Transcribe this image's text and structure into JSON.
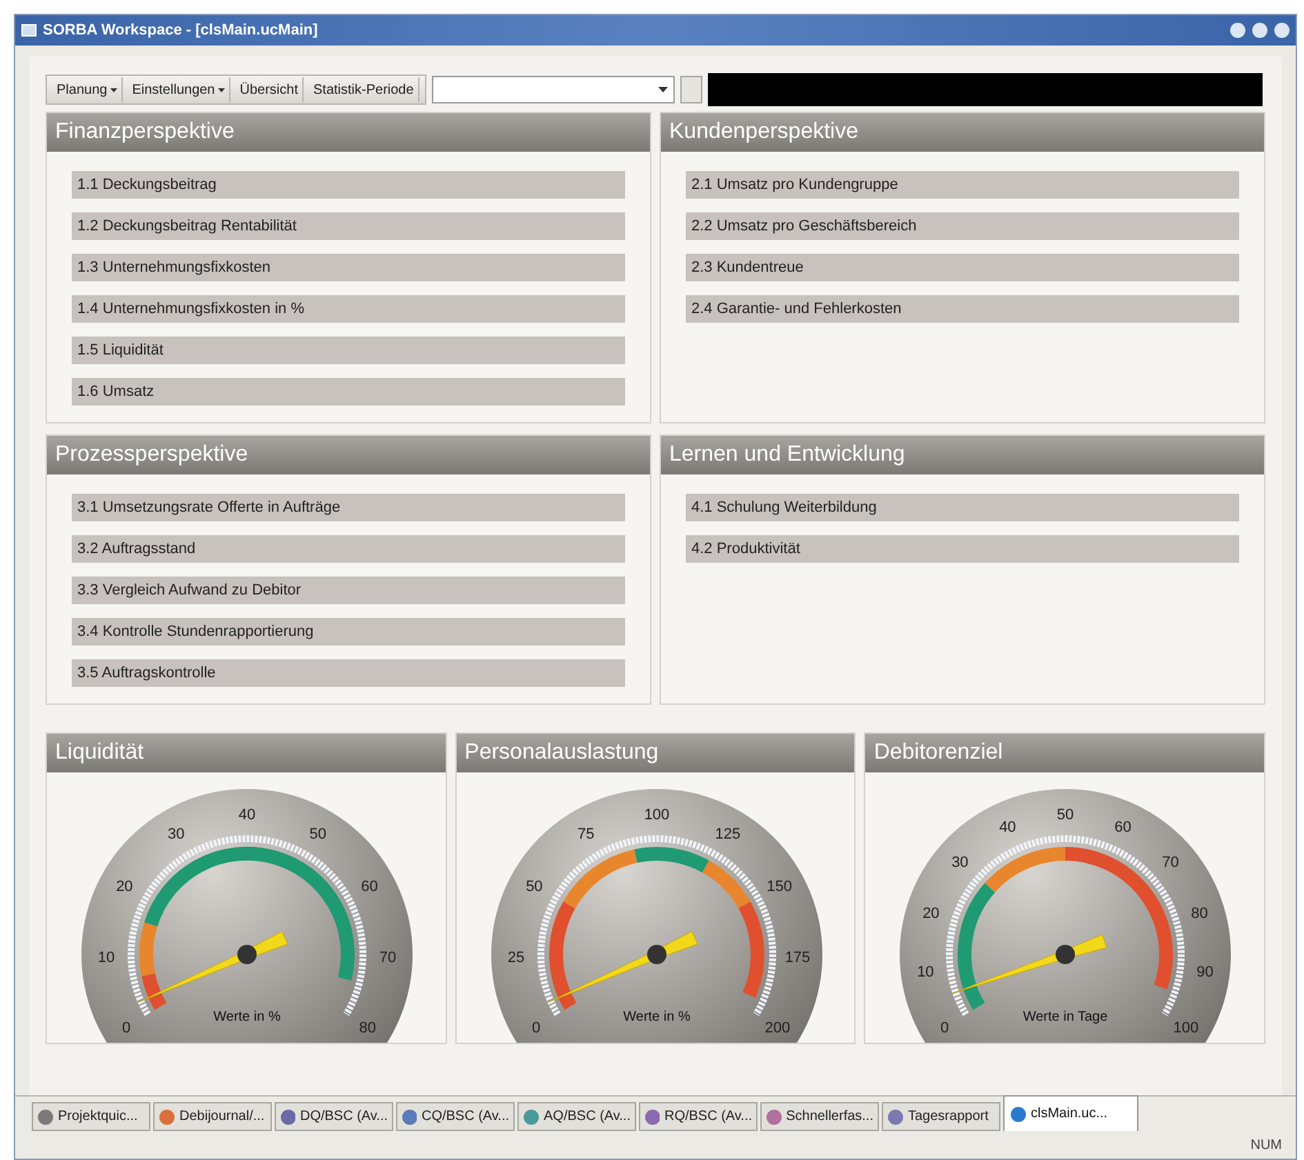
{
  "window": {
    "title": "SORBA Workspace - [clsMain.ucMain]"
  },
  "toolbar": {
    "menus": [
      {
        "label": "Planung",
        "dropdown": true
      },
      {
        "label": "Einstellungen",
        "dropdown": true
      },
      {
        "label": "Übersicht",
        "dropdown": false
      },
      {
        "label": "Statistik-Periode",
        "dropdown": false
      }
    ]
  },
  "panels": [
    {
      "title": "Finanzperspektive",
      "items": [
        "1.1 Deckungsbeitrag",
        "1.2 Deckungsbeitrag Rentabilität",
        "1.3 Unternehmungsfixkosten",
        "1.4 Unternehmungsfixkosten in %",
        "1.5 Liquidität",
        "1.6 Umsatz"
      ]
    },
    {
      "title": "Kundenperspektive",
      "items": [
        "2.1 Umsatz pro Kundengruppe",
        "2.2 Umsatz pro Geschäftsbereich",
        "2.3 Kundentreue",
        "2.4 Garantie- und Fehlerkosten"
      ]
    },
    {
      "title": "Prozessperspektive",
      "items": [
        "3.1 Umsetzungsrate Offerte in Aufträge",
        "3.2 Auftragsstand",
        "3.3 Vergleich Aufwand zu Debitor",
        "3.4 Kontrolle Stundenrapportierung",
        "3.5 Auftragskontrolle"
      ]
    },
    {
      "title": "Lernen und Entwicklung",
      "items": [
        "4.1 Schulung Weiterbildung",
        "4.2 Produktivität"
      ]
    }
  ],
  "gauges": [
    {
      "title": "Liquidität",
      "unit": "Werte in %",
      "ticks": [
        "0",
        "10",
        "20",
        "30",
        "40",
        "50",
        "60",
        "70",
        "80"
      ],
      "bands": [
        {
          "color": "#e0502e"
        },
        {
          "color": "#e8862e"
        },
        {
          "color": "#1f9a72"
        }
      ]
    },
    {
      "title": "Personalauslastung",
      "unit": "Werte in %",
      "ticks": [
        "0",
        "25",
        "50",
        "75",
        "100",
        "125",
        "150",
        "175",
        "200"
      ],
      "bands": [
        {
          "color": "#e0502e"
        },
        {
          "color": "#e8862e"
        },
        {
          "color": "#1f9a72"
        },
        {
          "color": "#e8862e"
        },
        {
          "color": "#e0502e"
        }
      ]
    },
    {
      "title": "Debitorenziel",
      "unit": "Werte in Tage",
      "ticks": [
        "0",
        "10",
        "20",
        "30",
        "40",
        "50",
        "60",
        "70",
        "80",
        "90",
        "100"
      ],
      "bands": [
        {
          "color": "#1f9a72"
        },
        {
          "color": "#e8862e"
        },
        {
          "color": "#e0502e"
        }
      ]
    }
  ],
  "taskbar": [
    {
      "label": "Projektquic...",
      "color": "#7a7a7a",
      "selected": false
    },
    {
      "label": "Debijournal/...",
      "color": "#d9703a",
      "selected": false
    },
    {
      "label": "DQ/BSC (Av...",
      "color": "#6a6aa8",
      "selected": false
    },
    {
      "label": "CQ/BSC (Av...",
      "color": "#5a7ab8",
      "selected": false
    },
    {
      "label": "AQ/BSC (Av...",
      "color": "#4a9a9a",
      "selected": false
    },
    {
      "label": "RQ/BSC (Av...",
      "color": "#8a6ab0",
      "selected": false
    },
    {
      "label": "Schnellerfas...",
      "color": "#b070a0",
      "selected": false
    },
    {
      "label": "Tagesrapport",
      "color": "#7a7ab0",
      "selected": false
    },
    {
      "label": "clsMain.uc...",
      "color": "#2a7ad0",
      "selected": true
    }
  ],
  "status_bar": {
    "indicator": "NUM"
  }
}
